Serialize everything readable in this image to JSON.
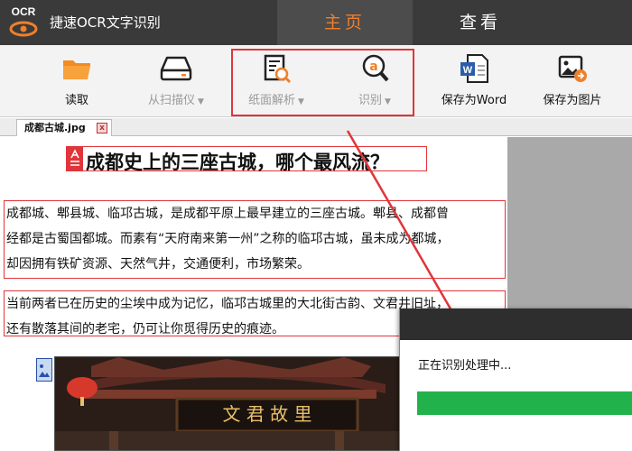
{
  "app": {
    "logo_text": "OCR",
    "title": "捷速OCR文字识别"
  },
  "nav": {
    "home": "主页",
    "view": "查看"
  },
  "toolbar": {
    "read": "读取",
    "scan": "从扫描仪",
    "parse": "纸面解析",
    "recognize": "识别",
    "save_word": "保存为Word",
    "save_image": "保存为图片"
  },
  "document_tab": {
    "filename": "成都古城.jpg",
    "close_glyph": "x"
  },
  "document": {
    "title": "成都史上的三座古城，哪个最风流？",
    "paragraph1": [
      "成都城、郫县城、临邛古城，是成都平原上最早建立的三座古城。郫县、成都曾",
      "经都是古蜀国都城。而素有“天府南来第一州”之称的临邛古城，虽未成为都城，",
      "却因拥有铁矿资源、天然气井，交通便利，市场繁荣。"
    ],
    "paragraph2": [
      "当前两者已在历史的尘埃中成为记忆，临邛古城里的大北街古韵、文君井旧址，",
      "还有散落其间的老宅，仍可让你觅得历史的痕迹。"
    ],
    "photo_sign": "文 君 故 里"
  },
  "dialog": {
    "message": "正在识别处理中...",
    "progress": 1.0
  },
  "colors": {
    "accent": "#f07f2a",
    "highlight": "#e0353a",
    "progress": "#22b24c",
    "titlebar": "#3a3a3a"
  }
}
